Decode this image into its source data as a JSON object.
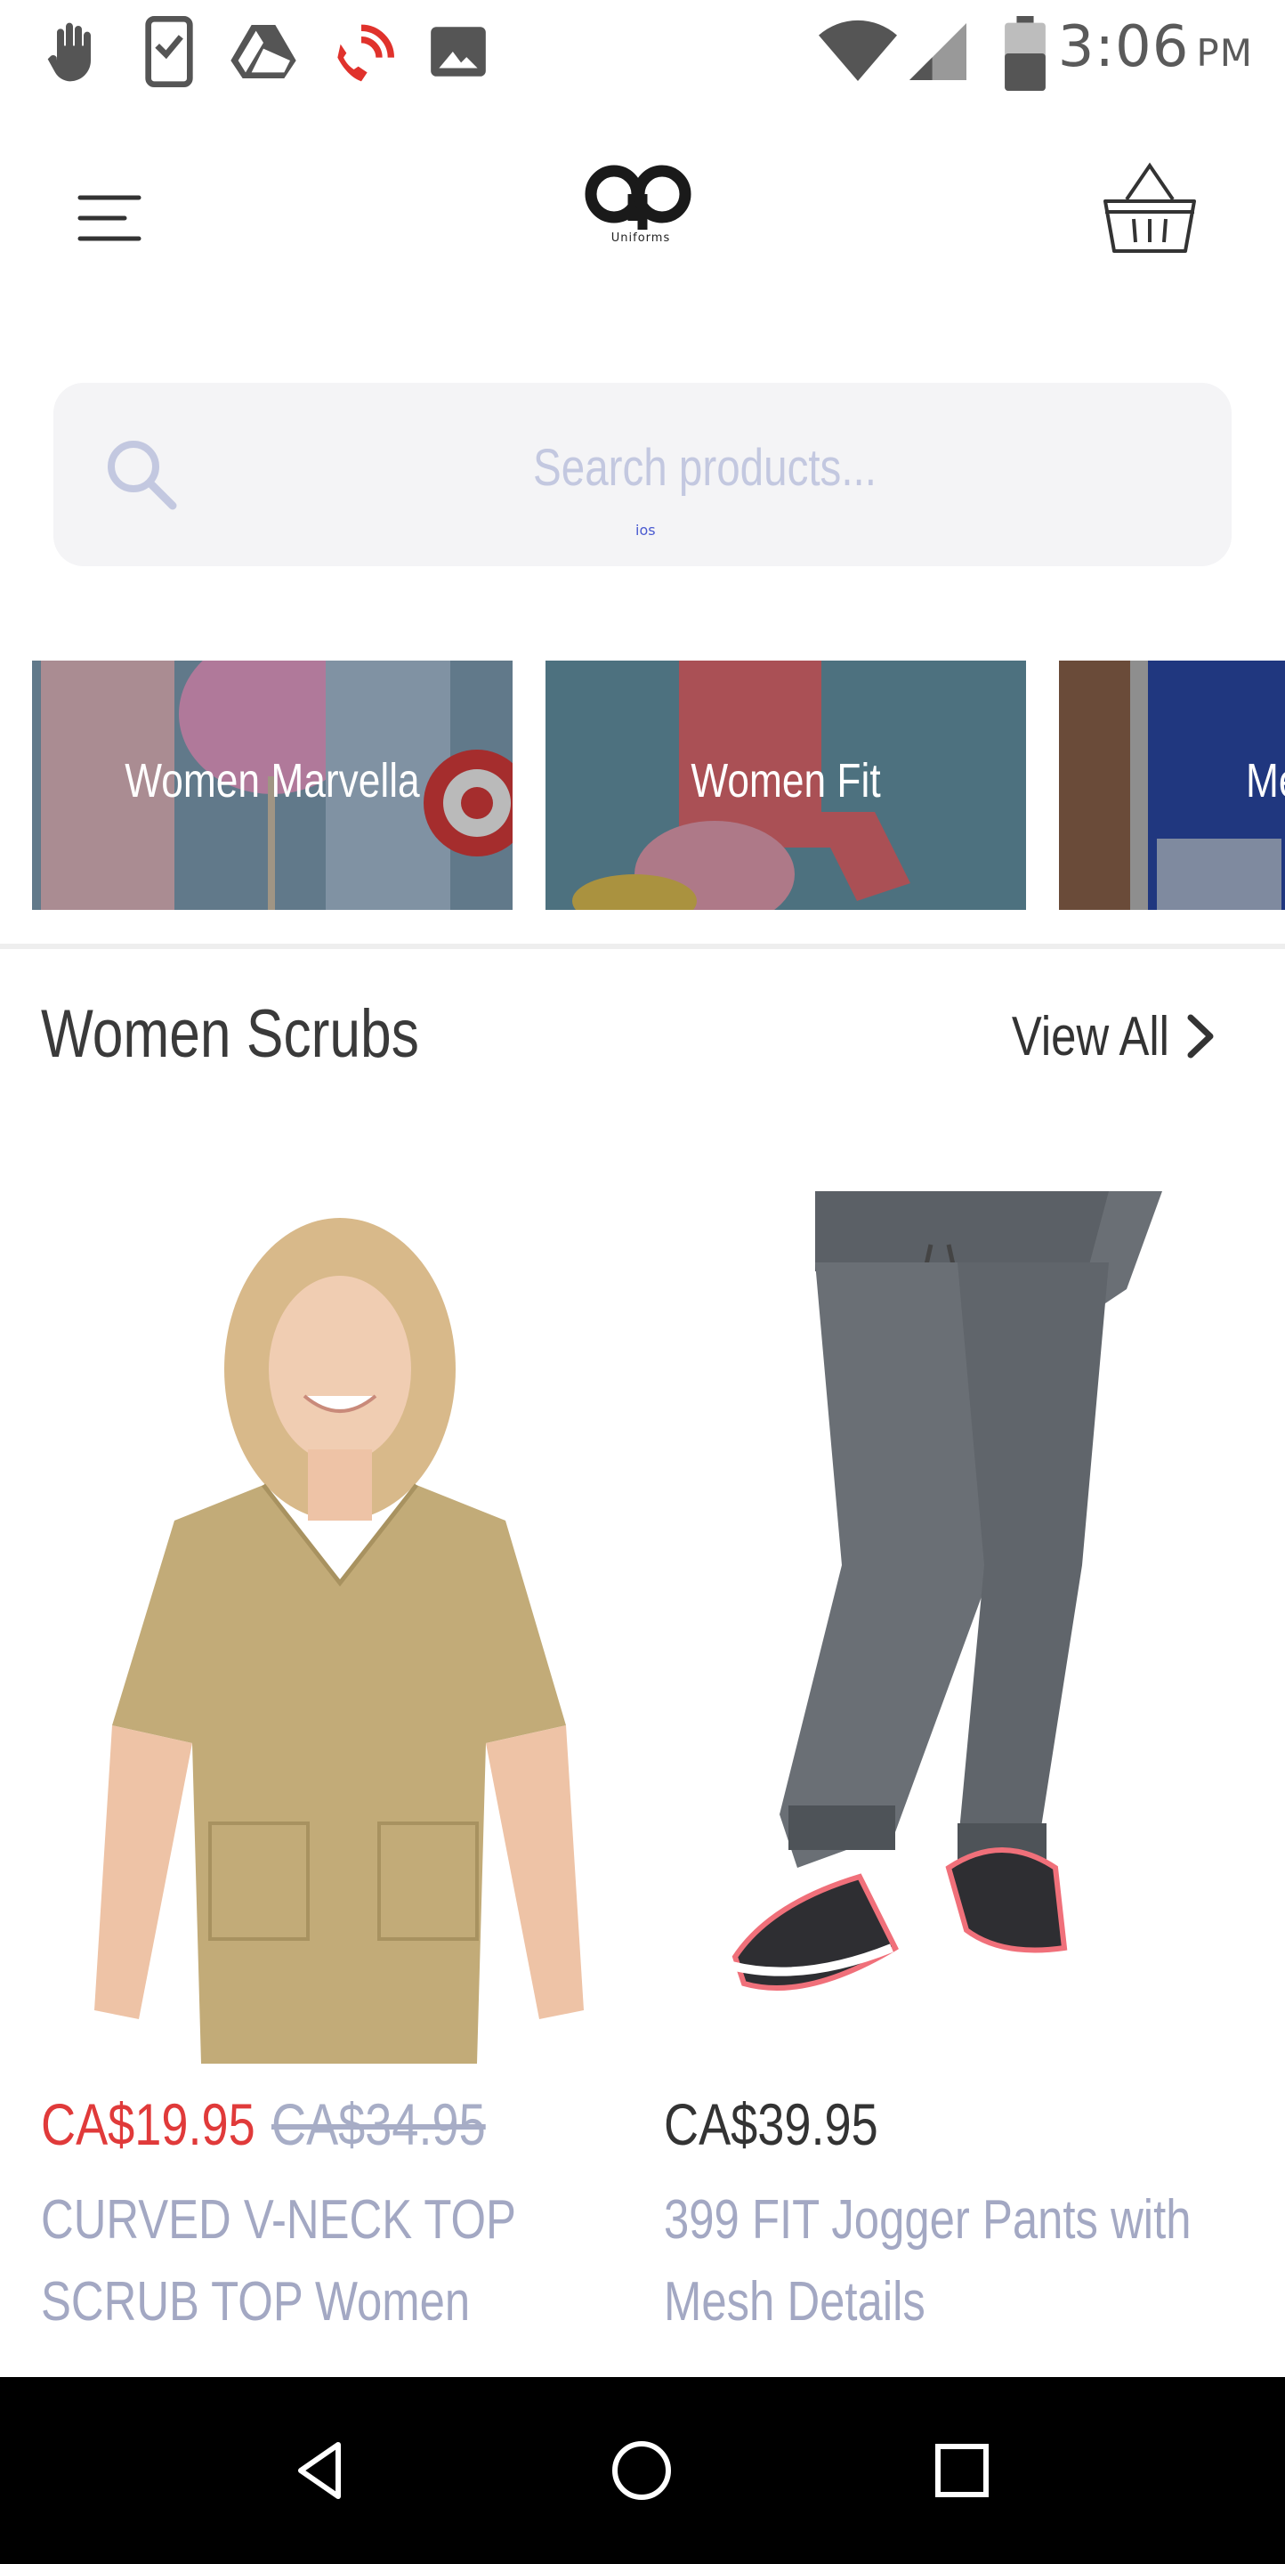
{
  "status_bar": {
    "time": "3:06",
    "ampm": "PM",
    "icons": [
      "hand-icon",
      "clipboard-phone-icon",
      "drive-icon",
      "wifi-call-icon",
      "image-icon",
      "wifi-icon",
      "signal-icon",
      "battery-icon"
    ]
  },
  "header": {
    "logo_tagline": "Uniforms",
    "menu_icon": "menu-icon",
    "cart_icon": "basket-icon"
  },
  "search": {
    "placeholder": "Search products...",
    "tiny_label": "ios"
  },
  "categories": [
    {
      "label": "Women Marvella"
    },
    {
      "label": "Women Fit"
    },
    {
      "label": "Me"
    }
  ],
  "section": {
    "title": "Women Scrubs",
    "view_all": "View All"
  },
  "products": [
    {
      "price": "CA$19.95",
      "old_price": "CA$34.95",
      "name": "CURVED V-NECK TOP SCRUB TOP Women *CLEARANCE S..."
    },
    {
      "price": "CA$39.95",
      "name": "399 FIT Jogger Pants with Mesh Details"
    }
  ],
  "colors": {
    "sale_price": "#e03a3a",
    "muted_text": "#a3a8c3",
    "search_bg": "#f4f4f6"
  }
}
